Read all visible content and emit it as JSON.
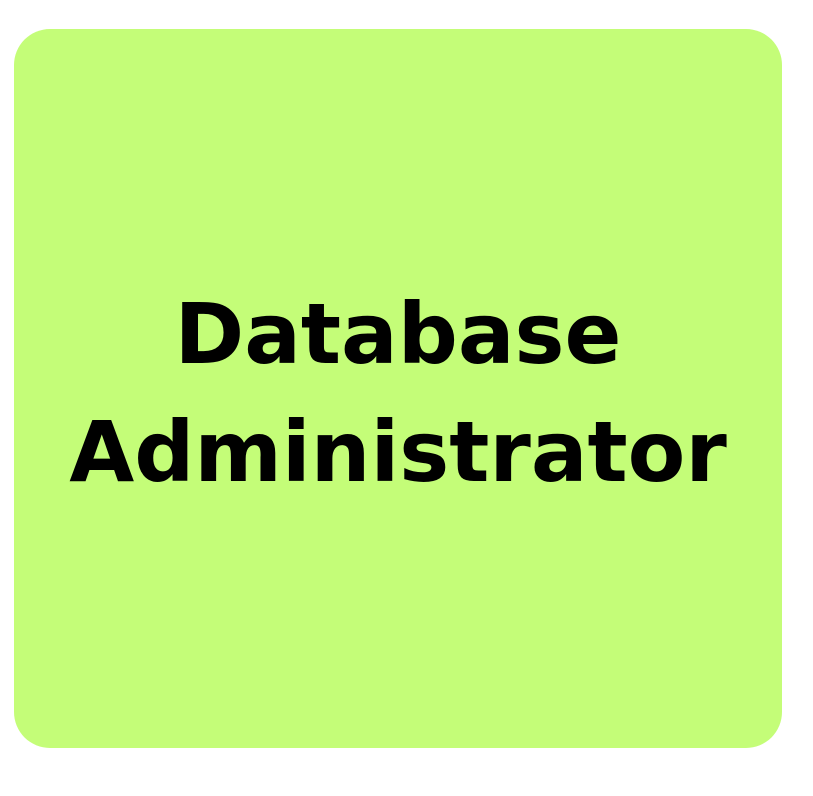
{
  "card": {
    "background": "#c4fd78",
    "text_color": "#000000",
    "title_lines": [
      "Database",
      "Administrator"
    ]
  }
}
